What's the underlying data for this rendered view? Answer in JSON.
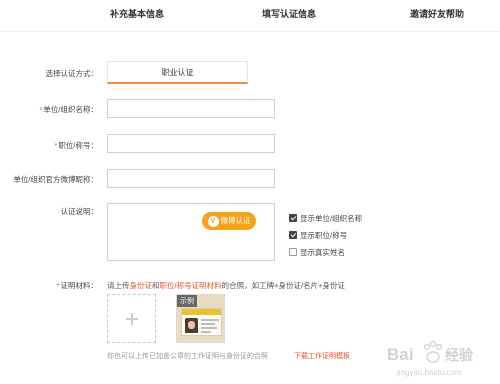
{
  "steps": [
    "补充基本信息",
    "填写认证信息",
    "邀请好友帮助"
  ],
  "auth_method": {
    "label": "选择认证方式：",
    "tab": "职业认证"
  },
  "fields": {
    "org_name": {
      "required": "*",
      "label": "单位/组织名称：",
      "value": ""
    },
    "title": {
      "required": "*",
      "label": "职位/称号：",
      "value": ""
    },
    "weibo": {
      "label": "单位/组织官方微博昵称：",
      "value": ""
    }
  },
  "description": {
    "label": "认证说明：",
    "value": "",
    "weibo_button": {
      "icon_letter": "V",
      "label": "微博认证"
    }
  },
  "options": [
    {
      "label": "显示单位/组织名称",
      "checked": true
    },
    {
      "label": "显示职位/称号",
      "checked": true
    },
    {
      "label": "显示真实姓名",
      "checked": false
    }
  ],
  "materials": {
    "required": "*",
    "label": "证明材料：",
    "text_1": "请上传",
    "link_1": "身份证",
    "text_2": "和",
    "link_2": "职位/称号证明材料",
    "text_3": "的合照，如工牌+身份证/名片+身份证",
    "sample_tag": "示例",
    "hint": "你也可以上传已加盖公章的工作证明与身份证的合照",
    "download_link": "下载工作证明模板"
  },
  "watermark": {
    "logo": "Bai",
    "cn": "经验",
    "url": "jingyan.baidu.com"
  },
  "colors": {
    "accent": "#f08c3c",
    "required": "#e8542a",
    "button": "#f5a31a"
  }
}
